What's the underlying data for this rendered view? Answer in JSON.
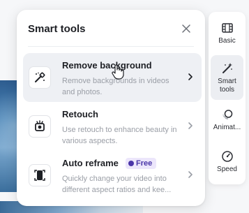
{
  "panel": {
    "title": "Smart tools",
    "tools": [
      {
        "name": "Remove background",
        "description": "Remove backgrounds in videos and photos.",
        "icon": "magic-eraser-icon"
      },
      {
        "name": "Retouch",
        "description": "Use retouch to enhance beauty in various aspects.",
        "icon": "retouch-icon"
      },
      {
        "name": "Auto reframe",
        "badge": "Free",
        "description": "Quickly change your video into different aspect ratios and kee...",
        "icon": "reframe-icon"
      }
    ]
  },
  "rail": {
    "items": [
      {
        "label": "Basic",
        "icon": "film-icon",
        "active": false
      },
      {
        "label": "Smart tools",
        "icon": "magic-wand-icon",
        "active": true
      },
      {
        "label": "Animat...",
        "icon": "animation-icon",
        "active": false
      },
      {
        "label": "Speed",
        "icon": "speedometer-icon",
        "active": false
      }
    ]
  },
  "colors": {
    "badge_bg": "#ece6fb",
    "badge_text": "#4a35a8",
    "hover_bg": "#eef0f4"
  }
}
